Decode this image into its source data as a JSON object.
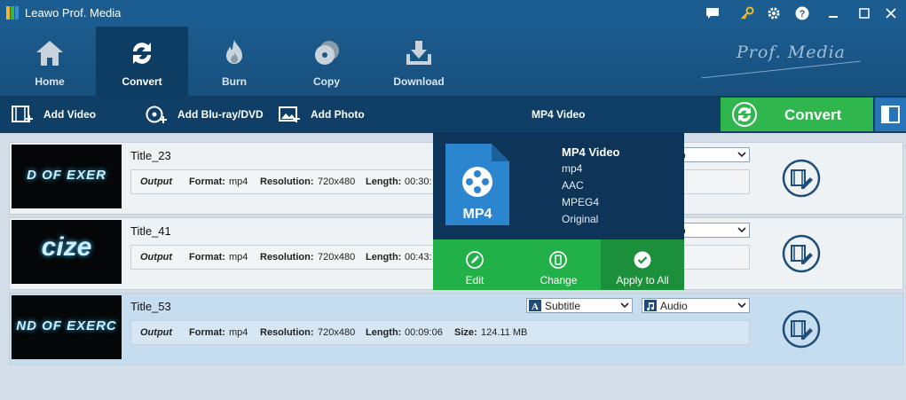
{
  "window": {
    "title": "Leawo Prof. Media"
  },
  "nav": {
    "items": [
      {
        "label": "Home",
        "icon": "home-icon"
      },
      {
        "label": "Convert",
        "icon": "convert-icon",
        "active": true
      },
      {
        "label": "Burn",
        "icon": "burn-icon"
      },
      {
        "label": "Copy",
        "icon": "copy-icon"
      },
      {
        "label": "Download",
        "icon": "download-icon"
      }
    ],
    "brand": "Prof. Media"
  },
  "toolbar": {
    "add_video": "Add Video",
    "add_bluray": "Add Blu-ray/DVD",
    "add_photo": "Add Photo",
    "format": "MP4 Video",
    "convert": "Convert"
  },
  "files": [
    {
      "title": "Title_23",
      "thumb_text": "D OF EXER",
      "output": "Output",
      "format_label": "Format:",
      "format": "mp4",
      "resolution_label": "Resolution:",
      "resolution": "720x480",
      "length_label": "Length:",
      "length": "00:30:",
      "subtitle_partial": "o"
    },
    {
      "title": "Title_41",
      "thumb_text": "cize",
      "output": "Output",
      "format_label": "Format:",
      "format": "mp4",
      "resolution_label": "Resolution:",
      "resolution": "720x480",
      "length_label": "Length:",
      "length": "00:43:",
      "subtitle_partial": "o"
    },
    {
      "title": "Title_53",
      "thumb_text": "ND OF EXERC",
      "output": "Output",
      "format_label": "Format:",
      "format": "mp4",
      "resolution_label": "Resolution:",
      "resolution": "720x480",
      "length_label": "Length:",
      "length": "00:09:06",
      "size_label": "Size:",
      "size": "124.11 MB",
      "subtitle": "Subtitle",
      "audio": "Audio"
    }
  ],
  "popup": {
    "icon_label": "MP4",
    "title": "MP4 Video",
    "lines": [
      "mp4",
      "AAC",
      "MPEG4",
      "Original"
    ],
    "actions": [
      {
        "label": "Edit",
        "icon": "pencil-icon"
      },
      {
        "label": "Change",
        "icon": "phone-icon"
      },
      {
        "label": "Apply to All",
        "icon": "check-icon",
        "active": true
      }
    ]
  },
  "colors": {
    "nav_bg": "#1c5b8d",
    "toolbar_bg": "#0f3f66",
    "convert_green": "#2fb64c",
    "popup_bg": "#0e3557"
  }
}
